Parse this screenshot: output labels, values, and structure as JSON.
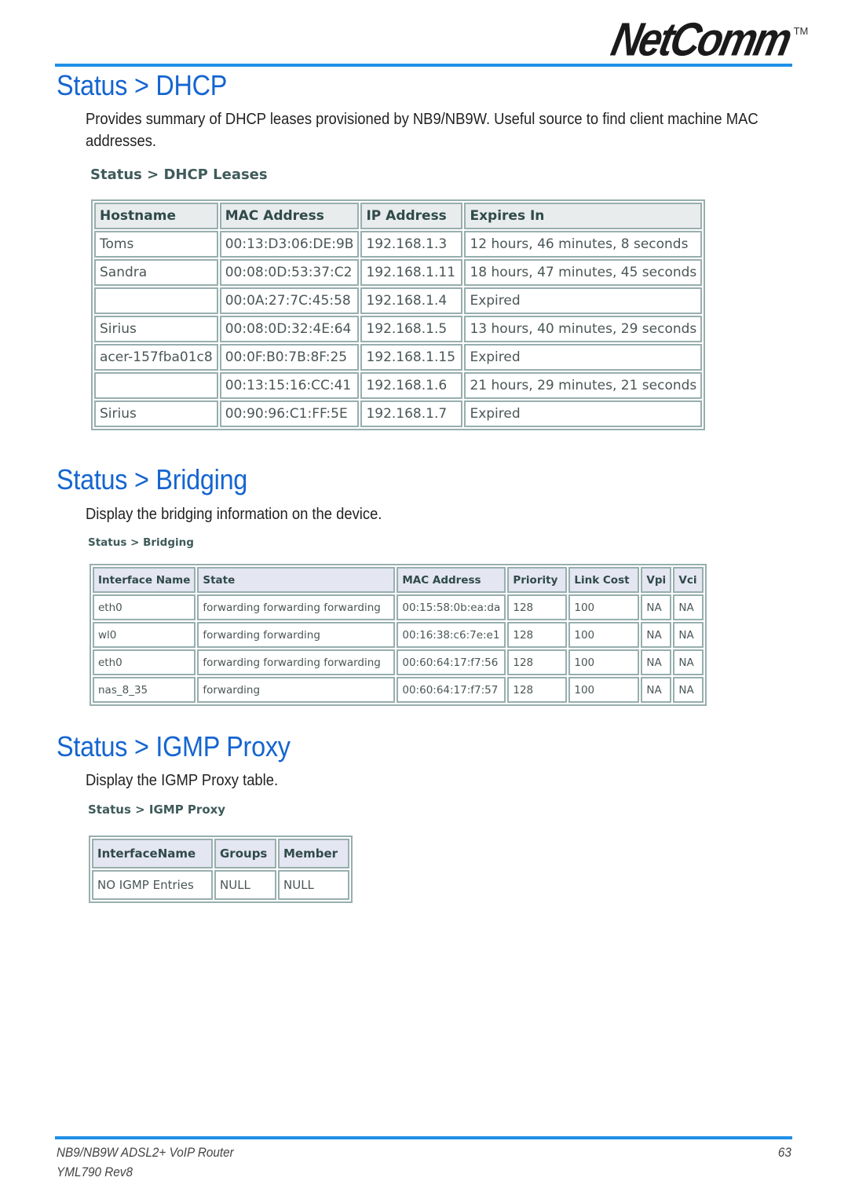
{
  "header": {
    "logo_text": "NetComm",
    "logo_trademark": "TM"
  },
  "sections": {
    "dhcp": {
      "title": "Status > DHCP",
      "description_line1": "Provides summary of DHCP leases provisioned by NB9/NB9W.  Useful source to find client machine MAC",
      "description_line2": "addresses.",
      "ui_caption": "Status > DHCP Leases",
      "table": {
        "headers": [
          "Hostname",
          "MAC Address",
          "IP Address",
          "Expires In"
        ],
        "rows": [
          [
            "Toms",
            "00:13:D3:06:DE:9B",
            "192.168.1.3",
            "12 hours, 46 minutes, 8 seconds"
          ],
          [
            "Sandra",
            "00:08:0D:53:37:C2",
            "192.168.1.11",
            "18 hours, 47 minutes, 45 seconds"
          ],
          [
            "",
            "00:0A:27:7C:45:58",
            "192.168.1.4",
            "Expired"
          ],
          [
            "Sirius",
            "00:08:0D:32:4E:64",
            "192.168.1.5",
            "13 hours, 40 minutes, 29 seconds"
          ],
          [
            "acer-157fba01c8",
            "00:0F:B0:7B:8F:25",
            "192.168.1.15",
            "Expired"
          ],
          [
            "",
            "00:13:15:16:CC:41",
            "192.168.1.6",
            "21 hours, 29 minutes, 21 seconds"
          ],
          [
            "Sirius",
            "00:90:96:C1:FF:5E",
            "192.168.1.7",
            "Expired"
          ]
        ]
      }
    },
    "bridging": {
      "title": "Status > Bridging",
      "description": "Display the bridging information on the device.",
      "ui_caption": "Status > Bridging",
      "table": {
        "headers": [
          "Interface Name",
          "State",
          "MAC Address",
          "Priority",
          "Link Cost",
          "Vpi",
          "Vci"
        ],
        "rows": [
          [
            "eth0",
            "forwarding forwarding forwarding",
            "00:15:58:0b:ea:da",
            "128",
            "100",
            "NA",
            "NA"
          ],
          [
            "wl0",
            "forwarding forwarding",
            "00:16:38:c6:7e:e1",
            "128",
            "100",
            "NA",
            "NA"
          ],
          [
            "eth0",
            "forwarding forwarding forwarding",
            "00:60:64:17:f7:56",
            "128",
            "100",
            "NA",
            "NA"
          ],
          [
            "nas_8_35",
            "forwarding",
            "00:60:64:17:f7:57",
            "128",
            "100",
            "NA",
            "NA"
          ]
        ]
      }
    },
    "igmp": {
      "title": "Status > IGMP Proxy",
      "description": "Display the IGMP Proxy table.",
      "ui_caption": "Status > IGMP Proxy",
      "table": {
        "headers": [
          "InterfaceName",
          "Groups",
          "Member"
        ],
        "rows": [
          [
            "NO IGMP Entries",
            "NULL",
            "NULL"
          ]
        ]
      }
    }
  },
  "footer": {
    "product": "NB9/NB9W ADSL2+ VoIP Router",
    "revision": "YML790 Rev8",
    "page_number": "63"
  },
  "colors": {
    "accent_rule": "#1e8fe6",
    "heading": "#1565d0"
  }
}
